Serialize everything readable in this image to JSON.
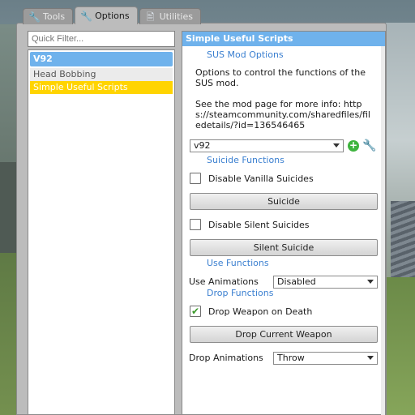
{
  "tabs": [
    {
      "label": "Tools",
      "icon": "wrench-icon"
    },
    {
      "label": "Options",
      "icon": "wrench-icon"
    },
    {
      "label": "Utilities",
      "icon": "utilities-icon"
    }
  ],
  "filter": {
    "placeholder": "Quick Filter..."
  },
  "tree": {
    "category": "V92",
    "items": [
      "Head Bobbing",
      "Simple Useful Scripts"
    ]
  },
  "panel": {
    "title": "Simple Useful Scripts",
    "section_title": "SUS Mod Options",
    "desc1": "Options to control the functions of the SUS mod.",
    "desc2": "See the mod page for more info: https://steamcommunity.com/sharedfiles/filedetails/?id=136546465",
    "preset": "v92",
    "suicide_header": "Suicide Functions",
    "disable_vanilla": "Disable Vanilla Suicides",
    "suicide_btn": "Suicide",
    "disable_silent": "Disable Silent Suicides",
    "silent_btn": "Silent Suicide",
    "use_header": "Use Functions",
    "use_anim_label": "Use Animations",
    "use_anim_value": "Disabled",
    "drop_header": "Drop Functions",
    "drop_on_death": "Drop Weapon on Death",
    "drop_current_btn": "Drop Current Weapon",
    "drop_anim_label": "Drop Animations",
    "drop_anim_value": "Throw"
  },
  "state": {
    "disable_vanilla_checked": false,
    "disable_silent_checked": false,
    "drop_on_death_checked": true
  },
  "colors": {
    "accent": "#6fb2ec",
    "selected": "#ffd400",
    "link": "#3a7fd0"
  }
}
